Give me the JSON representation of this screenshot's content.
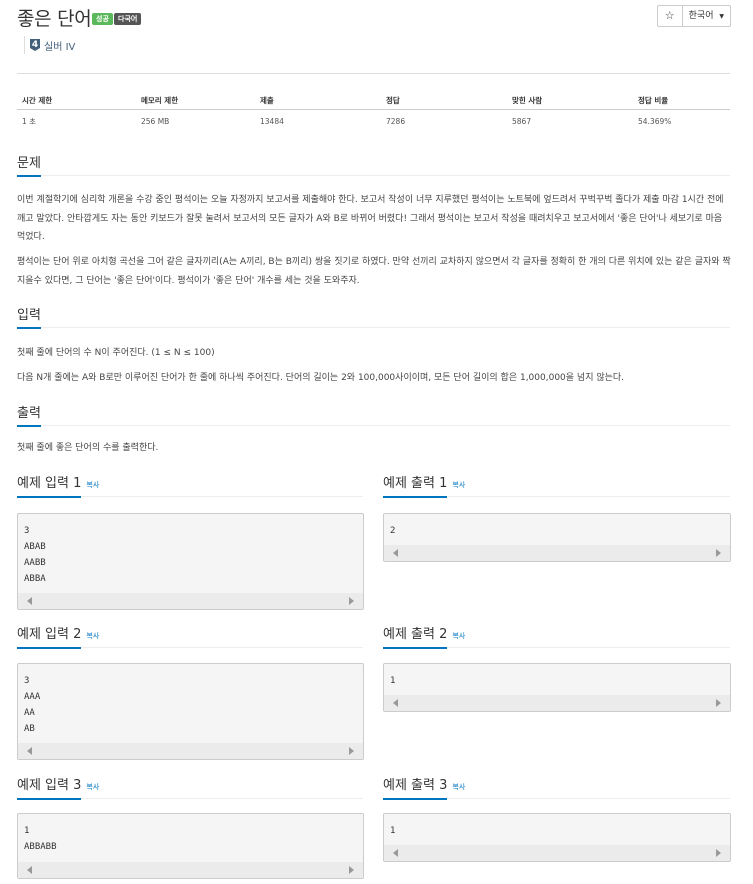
{
  "problem": {
    "title": "좋은 단어",
    "badges": [
      "성공",
      "다국어"
    ],
    "tier": "4",
    "tier_label": "실버 IV"
  },
  "toolbar": {
    "star": "☆",
    "language": "한국어"
  },
  "info_table": {
    "headers": [
      "시간 제한",
      "메모리 제한",
      "제출",
      "정답",
      "맞힌 사람",
      "정답 비율"
    ],
    "values": [
      "1 초",
      "256 MB",
      "13484",
      "7286",
      "5867",
      "54.369%"
    ]
  },
  "sections": {
    "description": {
      "title": "문제",
      "paragraphs": [
        "이번 계절학기에 심리학 개론을 수강 중인 평석이는 오늘 자정까지 보고서를 제출해야 한다. 보고서 작성이 너무 지루했던 평석이는 노트북에 엎드려서 꾸벅꾸벅 졸다가 제출 마감 1시간 전에 깨고 말았다. 안타깝게도 자는 동안 키보드가 잘못 눌려서 보고서의 모든 글자가 A와 B로 바뀌어 버렸다! 그래서 평석이는 보고서 작성을 때려치우고 보고서에서 '좋은 단어'나 세보기로 마음 먹었다.",
        "평석이는 단어 위로 아치형 곡선을 그어 같은 글자끼리(A는 A끼리, B는 B끼리) 쌍을 짓기로 하였다. 만약 선끼리 교차하지 않으면서 각 글자를 정확히 한 개의 다른 위치에 있는 같은 글자와 짝 지을수 있다면, 그 단어는 '좋은 단어'이다. 평석이가 '좋은 단어' 개수를 세는 것을 도와주자."
      ]
    },
    "input": {
      "title": "입력",
      "paragraphs": [
        "첫째 줄에 단어의 수 N이 주어진다. (1 ≤ N ≤ 100)",
        "다음 N개 줄에는 A와 B로만 이루어진 단어가 한 줄에 하나씩 주어진다. 단어의 길이는 2와 100,000사이이며, 모든 단어 길이의 합은 1,000,000을 넘지 않는다."
      ]
    },
    "output": {
      "title": "출력",
      "paragraphs": [
        "첫째 줄에 좋은 단어의 수를 출력한다."
      ]
    }
  },
  "copy_label": "복사",
  "samples": [
    {
      "input_title": "예제 입력 1",
      "output_title": "예제 출력 1",
      "input": "3\nABAB\nAABB\nABBA",
      "output": "2"
    },
    {
      "input_title": "예제 입력 2",
      "output_title": "예제 출력 2",
      "input": "3\nAAA\nAA\nAB",
      "output": "1"
    },
    {
      "input_title": "예제 입력 3",
      "output_title": "예제 출력 3",
      "input": "1\nABBABB",
      "output": "1"
    }
  ]
}
